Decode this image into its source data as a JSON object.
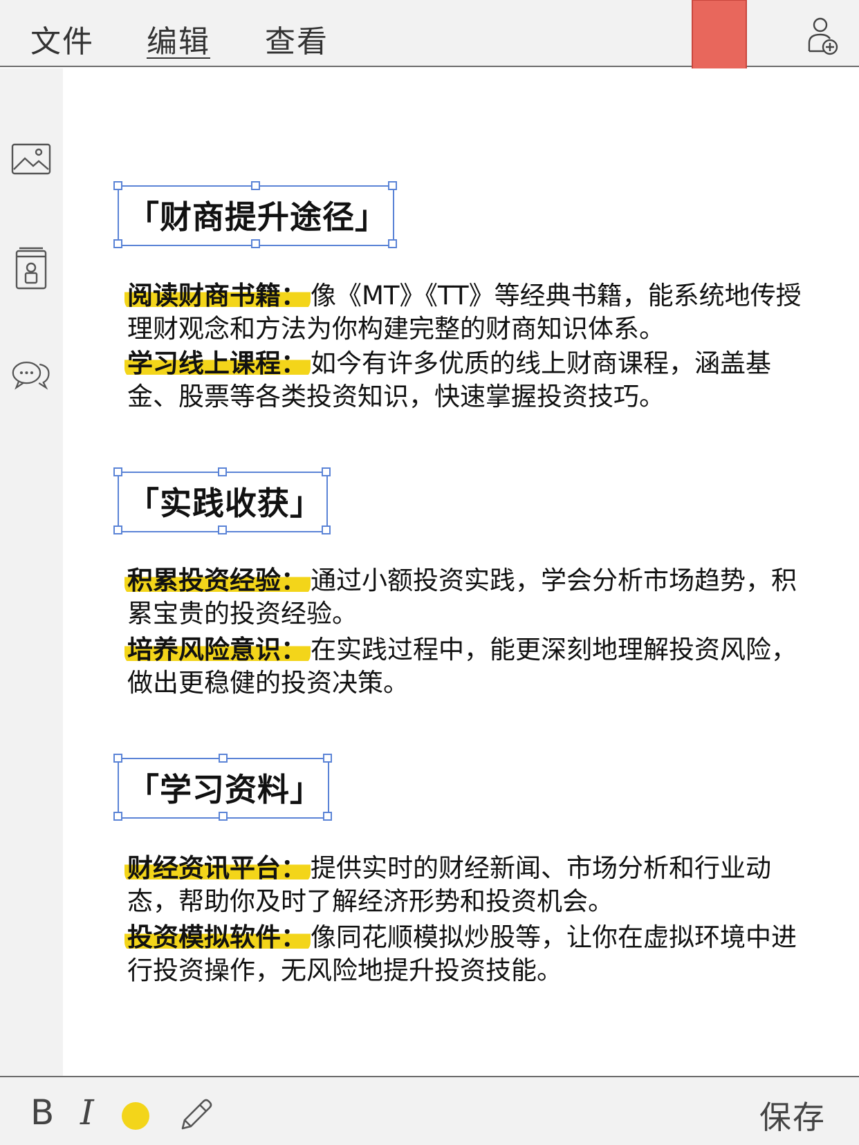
{
  "menu": {
    "file": "文件",
    "edit": "编辑",
    "view": "查看"
  },
  "colors": {
    "bookmark": "#e8675c",
    "highlight": "#f3d51a",
    "selection": "#5a83d6",
    "color_dot": "#f3d51a"
  },
  "sections": [
    {
      "heading": "「财商提升途径」",
      "items": [
        {
          "label": "阅读财商书籍：",
          "text": "像《MT》《TT》等经典书籍，能系统地传授理财观念和方法为你构建完整的财商知识体系。"
        },
        {
          "label": "学习线上课程：",
          "text": "如今有许多优质的线上财商课程，涵盖基金、股票等各类投资知识，快速掌握投资技巧。"
        }
      ]
    },
    {
      "heading": "「实践收获」",
      "items": [
        {
          "label": "积累投资经验：",
          "text": "通过小额投资实践，学会分析市场趋势，积累宝贵的投资经验。"
        },
        {
          "label": "培养风险意识：",
          "text": "在实践过程中，能更深刻地理解投资风险，做出更稳健的投资决策。"
        }
      ]
    },
    {
      "heading": "「学习资料」",
      "items": [
        {
          "label": "财经资讯平台：",
          "text": "提供实时的财经新闻、市场分析和行业动态，帮助你及时了解经济形势和投资机会。"
        },
        {
          "label": "投资模拟软件：",
          "text": "像同花顺模拟炒股等，让你在虚拟环境中进行投资操作，无风险地提升投资技能。"
        }
      ]
    }
  ],
  "toolbar": {
    "bold": "B",
    "italic": "I",
    "save": "保存"
  },
  "icons": {
    "sidebar": [
      "image-icon",
      "contact-icon",
      "comment-icon"
    ],
    "top_right": "add-user-icon",
    "bottom": "pencil-icon"
  }
}
